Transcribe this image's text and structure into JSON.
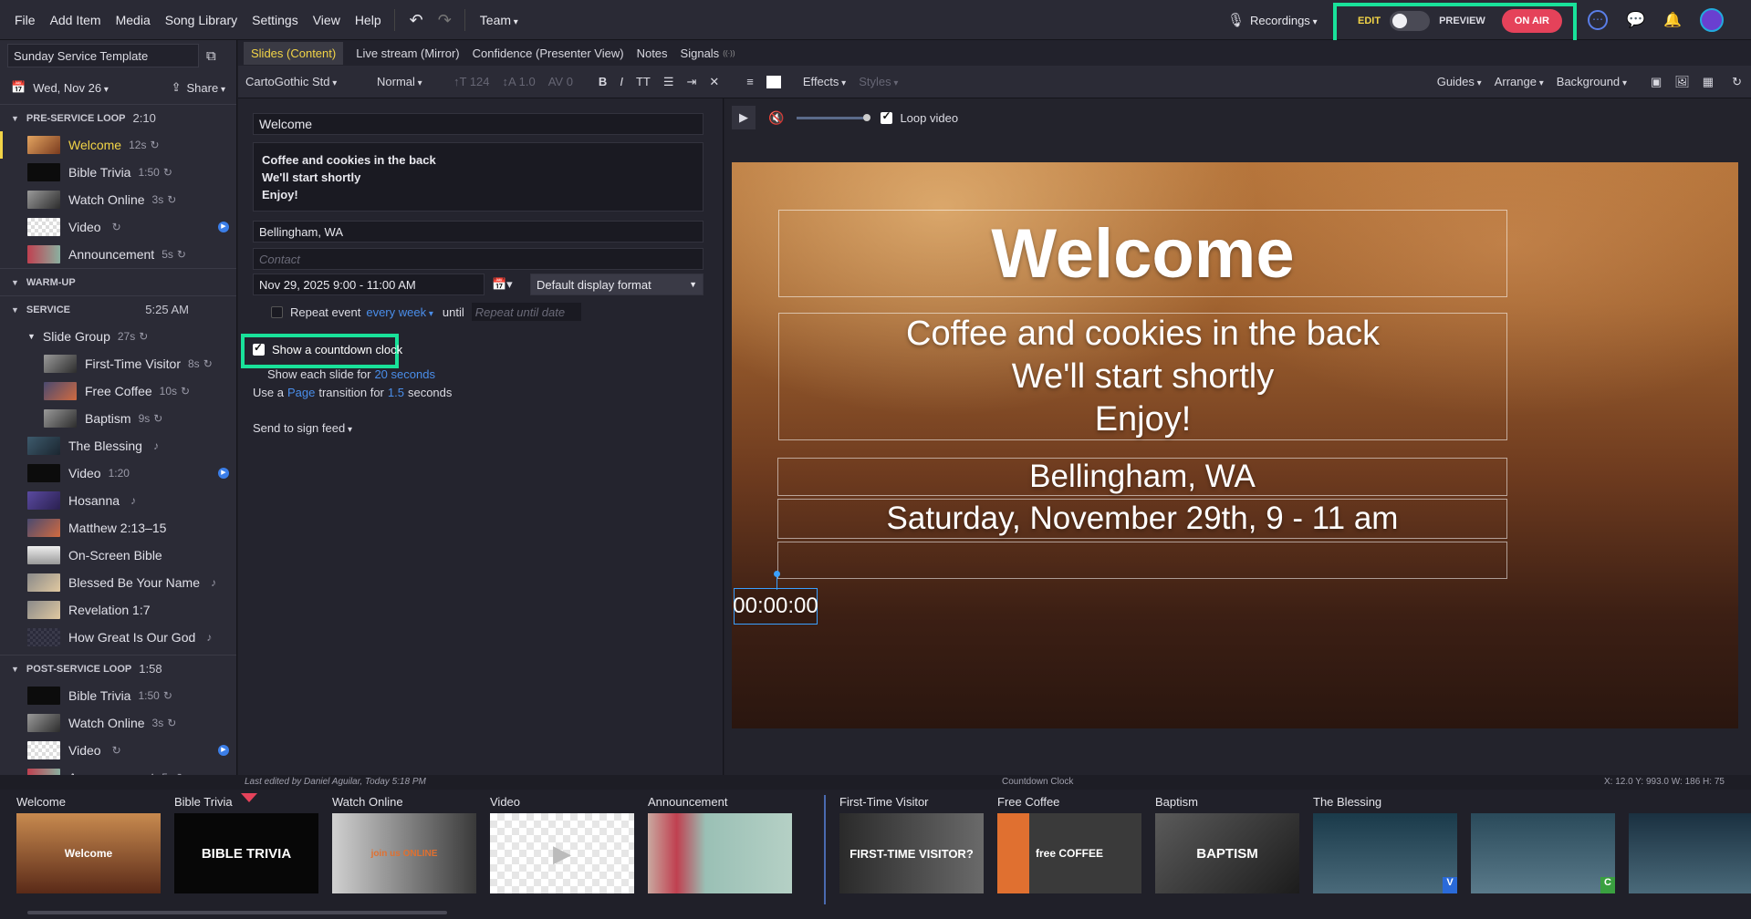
{
  "menubar": {
    "items": [
      "File",
      "Add Item",
      "Media",
      "Song Library",
      "Settings",
      "View",
      "Help"
    ],
    "team": "Team",
    "recordings": "Recordings",
    "edit": "EDIT",
    "preview": "PREVIEW",
    "on_air": "ON AIR"
  },
  "sidebar": {
    "service_name": "Sunday Service Template",
    "date": "Wed, Nov 26",
    "share": "Share",
    "pre_service": {
      "title": "PRE-SERVICE LOOP",
      "time": "2:10"
    },
    "pre_items": [
      {
        "label": "Welcome",
        "dur": "12s"
      },
      {
        "label": "Bible Trivia",
        "dur": "1:50"
      },
      {
        "label": "Watch Online",
        "dur": "3s"
      },
      {
        "label": "Video",
        "dur": ""
      },
      {
        "label": "Announcement",
        "dur": "5s"
      }
    ],
    "warm_up": "WARM-UP",
    "service": {
      "title": "SERVICE",
      "time": "5:25 AM"
    },
    "slide_group": {
      "label": "Slide Group",
      "dur": "27s"
    },
    "group_items": [
      {
        "label": "First-Time Visitor",
        "dur": "8s"
      },
      {
        "label": "Free Coffee",
        "dur": "10s"
      },
      {
        "label": "Baptism",
        "dur": "9s"
      }
    ],
    "service_items": [
      {
        "label": "The Blessing",
        "dur": ""
      },
      {
        "label": "Video",
        "dur": "1:20"
      },
      {
        "label": "Hosanna",
        "dur": ""
      },
      {
        "label": "Matthew 2:13–15",
        "dur": ""
      },
      {
        "label": "On-Screen Bible",
        "dur": ""
      },
      {
        "label": "Blessed Be Your Name",
        "dur": ""
      },
      {
        "label": "Revelation 1:7",
        "dur": ""
      },
      {
        "label": "How Great Is Our God",
        "dur": ""
      }
    ],
    "post_service": {
      "title": "POST-SERVICE LOOP",
      "time": "1:58"
    },
    "post_items": [
      {
        "label": "Bible Trivia",
        "dur": "1:50"
      },
      {
        "label": "Watch Online",
        "dur": "3s"
      },
      {
        "label": "Video",
        "dur": ""
      },
      {
        "label": "Announcement",
        "dur": "5s"
      }
    ]
  },
  "tabs": [
    "Slides (Content)",
    "Live stream (Mirror)",
    "Confidence (Presenter View)",
    "Notes",
    "Signals"
  ],
  "toolbar": {
    "font": "CartoGothic Std",
    "style": "Normal",
    "size": "124",
    "line": "1.0",
    "spacing": "0",
    "effects": "Effects",
    "styles": "Styles",
    "guides": "Guides",
    "arrange": "Arrange",
    "background": "Background"
  },
  "editor": {
    "title": "Welcome",
    "body_lines": [
      "Coffee and cookies in the back",
      "We'll start shortly",
      "Enjoy!"
    ],
    "location": "Bellingham, WA",
    "contact_placeholder": "Contact",
    "datetime": "Nov 29, 2025 9:00 - 11:00 AM",
    "display_format": "Default display format",
    "repeat_label": "Repeat event",
    "repeat_value": "every week",
    "until": "until",
    "repeat_until_placeholder": "Repeat until date",
    "countdown": "Show a countdown clock",
    "show_each_prefix": "Show each slide for",
    "show_each_value": "20 seconds",
    "transition_prefix": "Use a",
    "transition_type": "Page",
    "transition_mid": "transition for",
    "transition_value": "1.5",
    "transition_suffix": "seconds",
    "sign_feed": "Send to sign feed"
  },
  "preview": {
    "loop_video": "Loop video",
    "slide_title": "Welcome",
    "slide_lines": [
      "Coffee and cookies in the back",
      "We'll start shortly",
      "Enjoy!"
    ],
    "slide_location": "Bellingham, WA",
    "slide_date": "Saturday, November 29th, 9 - 11 am",
    "countdown": "00:00:00"
  },
  "status": {
    "last_edited": "Last edited by Daniel Aguilar, Today 5:18 PM",
    "selection": "Countdown Clock",
    "coords": "X: 12.0  Y: 993.0    W: 186  H: 75"
  },
  "filmstrip": {
    "cards": [
      {
        "label": "Welcome",
        "text": "Welcome"
      },
      {
        "label": "Bible Trivia",
        "text": "BIBLE TRIVIA"
      },
      {
        "label": "Watch Online",
        "text": "join us ONLINE"
      },
      {
        "label": "Video",
        "text": ""
      },
      {
        "label": "Announcement",
        "text": ""
      },
      {
        "label": "First-Time Visitor",
        "text": "FIRST-TIME VISITOR?"
      },
      {
        "label": "Free Coffee",
        "text": "free COFFEE"
      },
      {
        "label": "Baptism",
        "text": "BAPTISM"
      },
      {
        "label": "The Blessing",
        "text": "V"
      },
      {
        "label": "",
        "text": "C"
      },
      {
        "label": "",
        "text": ""
      }
    ]
  },
  "colors": {
    "accent_highlight": "#19e29a",
    "on_air": "#e5425a",
    "active_tab": "#f2d447",
    "link": "#4a8eea"
  }
}
